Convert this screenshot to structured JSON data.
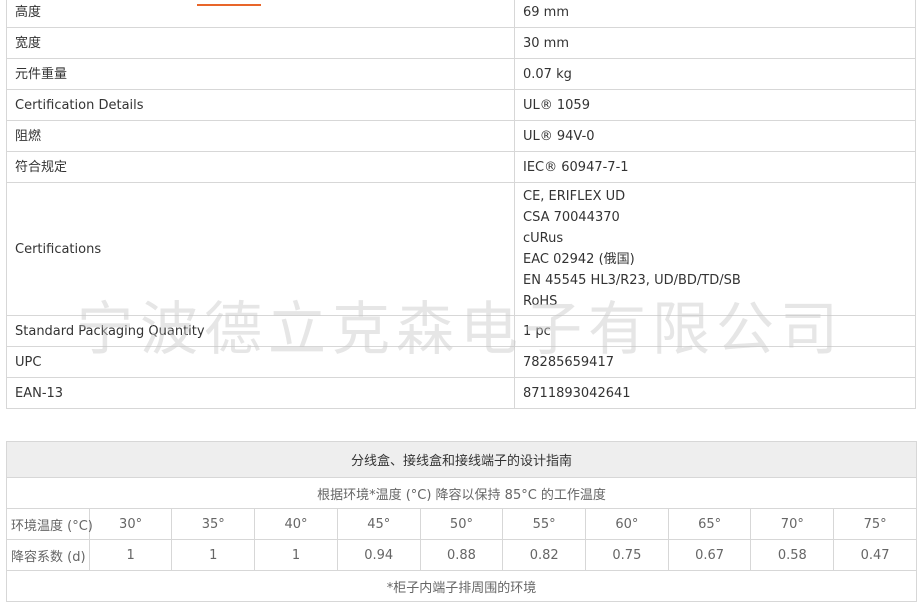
{
  "specs": [
    {
      "label": "高度",
      "value": "69 mm"
    },
    {
      "label": "宽度",
      "value": "30 mm"
    },
    {
      "label": "元件重量",
      "value": "0.07 kg"
    },
    {
      "label": "Certification Details",
      "value": "UL® 1059"
    },
    {
      "label": "阻燃",
      "value": "UL® 94V-0"
    },
    {
      "label": "符合规定",
      "value": "IEC® 60947-7-1"
    }
  ],
  "certifications": {
    "label": "Certifications",
    "values": [
      "CE, ERIFLEX UD",
      "CSA 70044370",
      "cURus",
      "EAC 02942 (俄国)",
      "EN 45545 HL3/R23, UD/BD/TD/SB",
      "RoHS"
    ]
  },
  "specs_tail": [
    {
      "label": "Standard Packaging Quantity",
      "value": "1 pc"
    },
    {
      "label": "UPC",
      "value": "78285659417"
    },
    {
      "label": "EAN-13",
      "value": "8711893042641"
    }
  ],
  "watermark": "宁波德立克森电子有限公司",
  "guide": {
    "title": "分线盒、接线盒和接线端子的设计指南",
    "subtitle": "根据环境*温度 (°C) 降容以保持 85°C 的工作温度",
    "temp_label": "环境温度 (°C)",
    "temps": [
      "30°",
      "35°",
      "40°",
      "45°",
      "50°",
      "55°",
      "60°",
      "65°",
      "70°",
      "75°"
    ],
    "factor_label": "降容系数 (d)",
    "factors": [
      "1",
      "1",
      "1",
      "0.94",
      "0.88",
      "0.82",
      "0.75",
      "0.67",
      "0.58",
      "0.47"
    ],
    "footnote": "*柜子内端子排周围的环境"
  },
  "colors": {
    "accent": "#e8662a",
    "border": "#d7d7d7",
    "header_bg": "#eeeeee"
  }
}
